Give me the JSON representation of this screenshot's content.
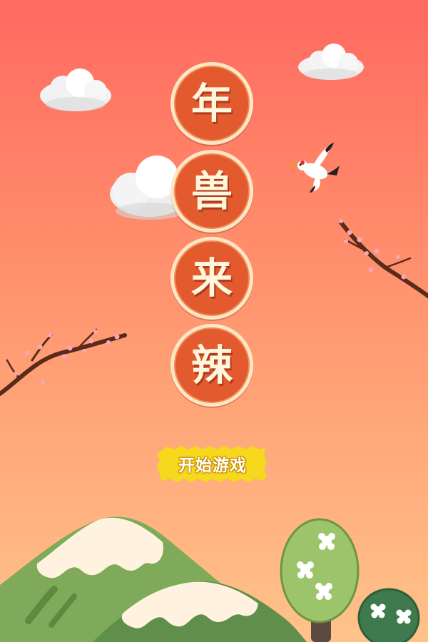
{
  "game": {
    "title_chars": [
      "年",
      "兽",
      "来",
      "辣"
    ],
    "start_label": "开始游戏"
  },
  "colors": {
    "sky_top": "#ff6a61",
    "sky_bottom": "#ffc38a",
    "badge_fill": "#e35a2e",
    "badge_ring": "#ffe7c4",
    "title_text": "#fff6dc",
    "button_fill": "#f6d81c",
    "mountain_green": "#7faa5a",
    "snow": "#fff3df"
  },
  "icons": {
    "bird": "crane-icon",
    "cloud": "cloud-icon",
    "branch": "plum-blossom-branch-icon",
    "tree": "flowering-tree-icon",
    "mountain": "snowy-mountain-icon"
  }
}
